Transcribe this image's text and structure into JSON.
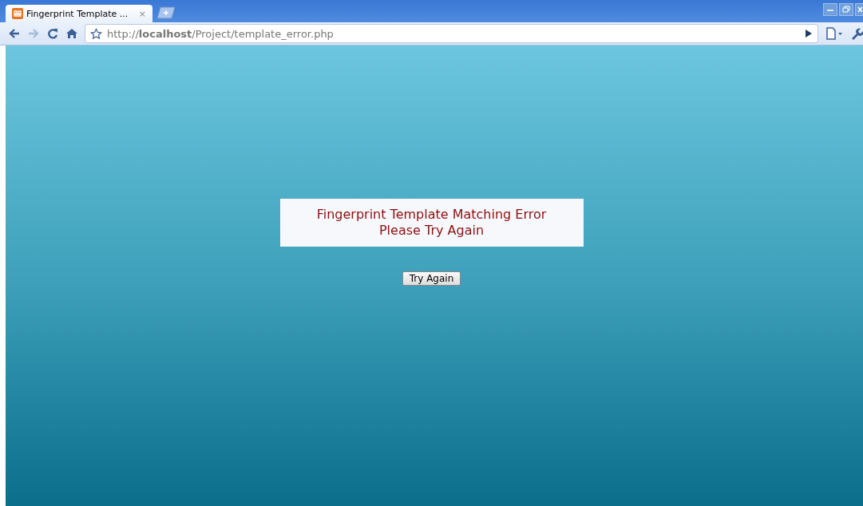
{
  "tab": {
    "title": "Fingerprint Template ...",
    "close": "×",
    "selected": true
  },
  "address": {
    "url": "http://**localhost**/Project/template_error.php"
  },
  "message": {
    "lines": [
      "Fingerprint Template Matching Error",
      "Please Try Again"
    ]
  },
  "button": {
    "label": "Try Again"
  }
}
